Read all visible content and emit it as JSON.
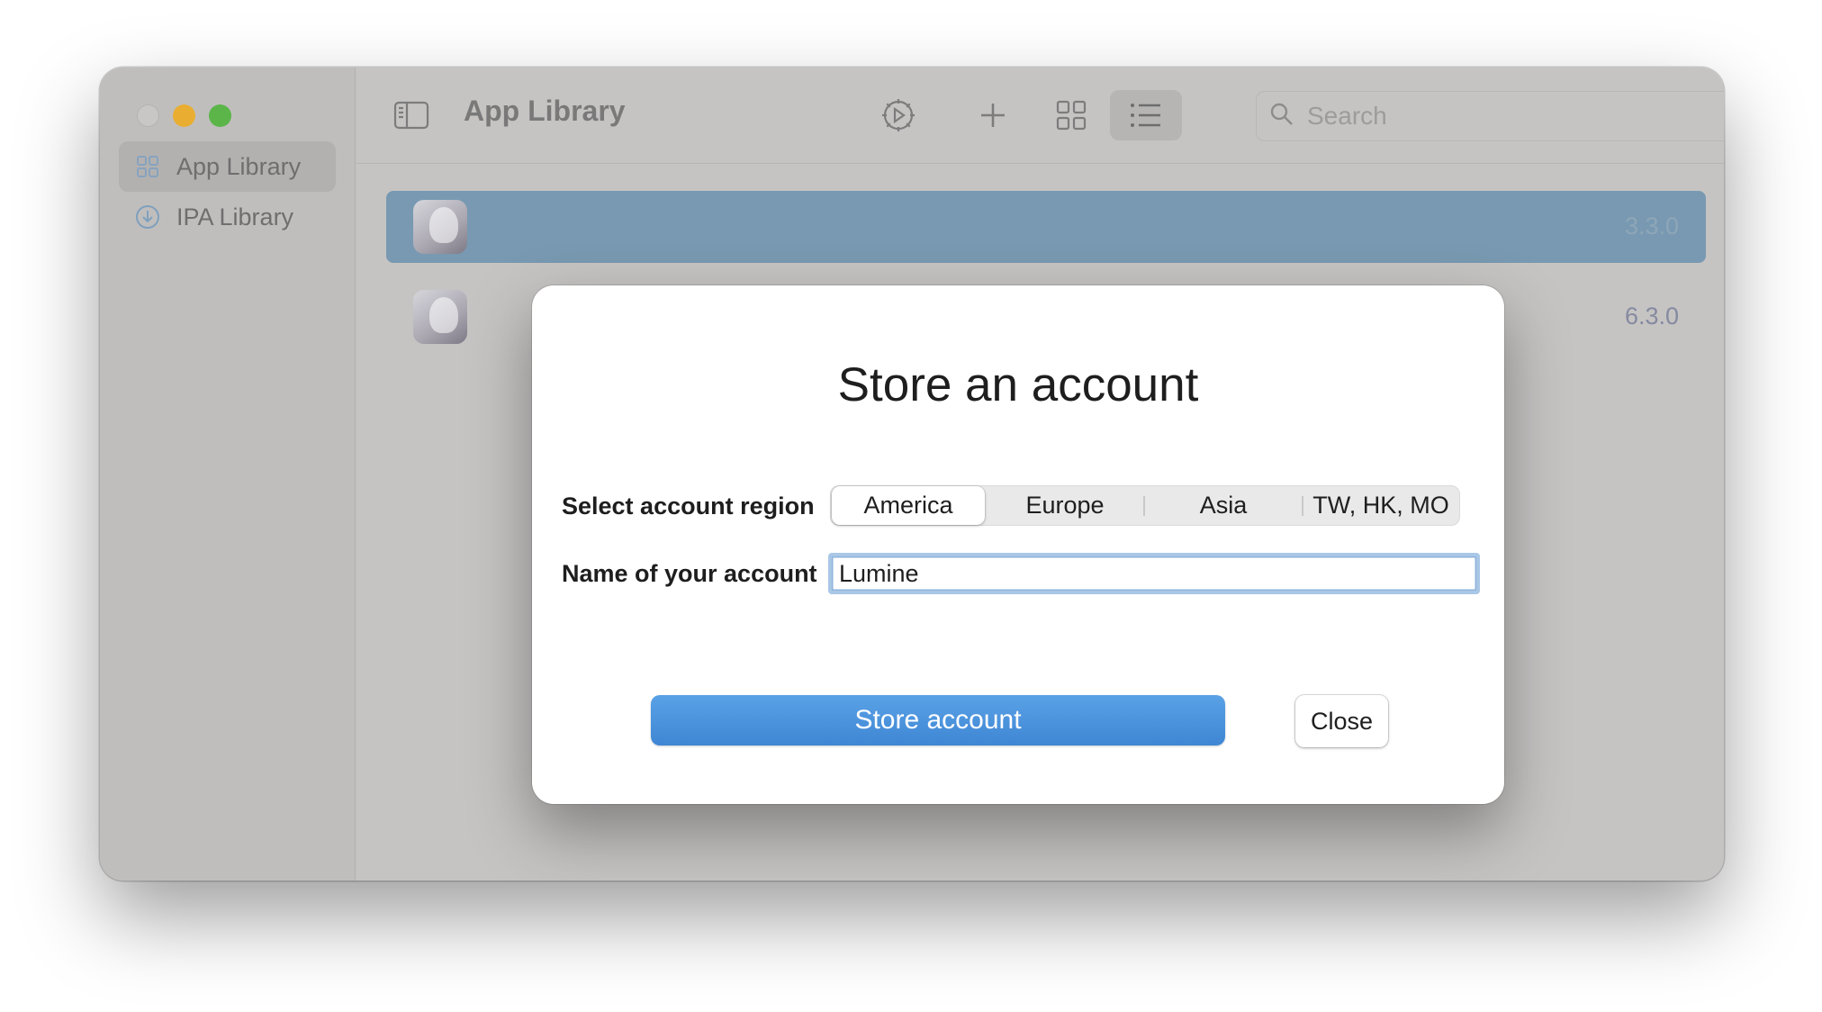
{
  "window": {
    "traffic_lights": [
      "close",
      "minimize",
      "maximize"
    ]
  },
  "sidebar": {
    "items": [
      {
        "label": "App Library",
        "icon": "grid-icon",
        "active": true
      },
      {
        "label": "IPA Library",
        "icon": "download-circle-icon",
        "active": false
      }
    ]
  },
  "toolbar": {
    "title": "App Library",
    "icons": [
      "sidebar-toggle-icon",
      "settings-gear-icon",
      "plus-icon",
      "grid-view-icon",
      "list-view-icon"
    ],
    "search_placeholder": "Search"
  },
  "list": {
    "rows": [
      {
        "version": "3.3.0",
        "selected": true
      },
      {
        "version": "6.3.0",
        "selected": false
      }
    ]
  },
  "dialog": {
    "title": "Store an account",
    "region_label": "Select account region",
    "regions": [
      "America",
      "Europe",
      "Asia",
      "TW, HK, MO"
    ],
    "selected_region": "America",
    "name_label": "Name of your account",
    "name_value": "Lumine",
    "store_button": "Store account",
    "close_button": "Close"
  },
  "colors": {
    "accent_blue": "#4a92dc",
    "selected_row": "#7899b1",
    "traffic_minimize": "#e9ae31",
    "traffic_maximize": "#5bb549"
  }
}
